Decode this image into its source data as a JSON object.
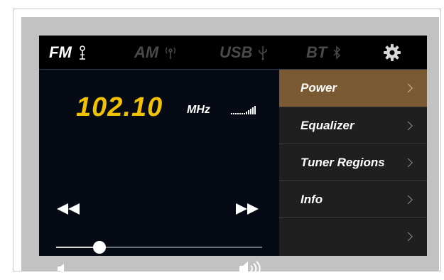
{
  "sources": [
    {
      "label": "FM",
      "icon": "antenna-icon",
      "active": true
    },
    {
      "label": "AM",
      "icon": "radio-wave-icon",
      "active": false
    },
    {
      "label": "USB",
      "icon": "usb-icon",
      "active": false
    },
    {
      "label": "BT",
      "icon": "bluetooth-icon",
      "active": false
    }
  ],
  "player": {
    "frequency": "102.10",
    "unit": "MHz",
    "volume_level": 0.21
  },
  "menu": {
    "items": [
      {
        "label": "Power",
        "active": true
      },
      {
        "label": "Equalizer",
        "active": false
      },
      {
        "label": "Tuner Regions",
        "active": false
      },
      {
        "label": "Info",
        "active": false
      },
      {
        "label": "",
        "active": false
      }
    ]
  },
  "colors": {
    "frequency": "#f2c200",
    "menu_active": "#7a5a33",
    "screen": "#0a0f18"
  }
}
